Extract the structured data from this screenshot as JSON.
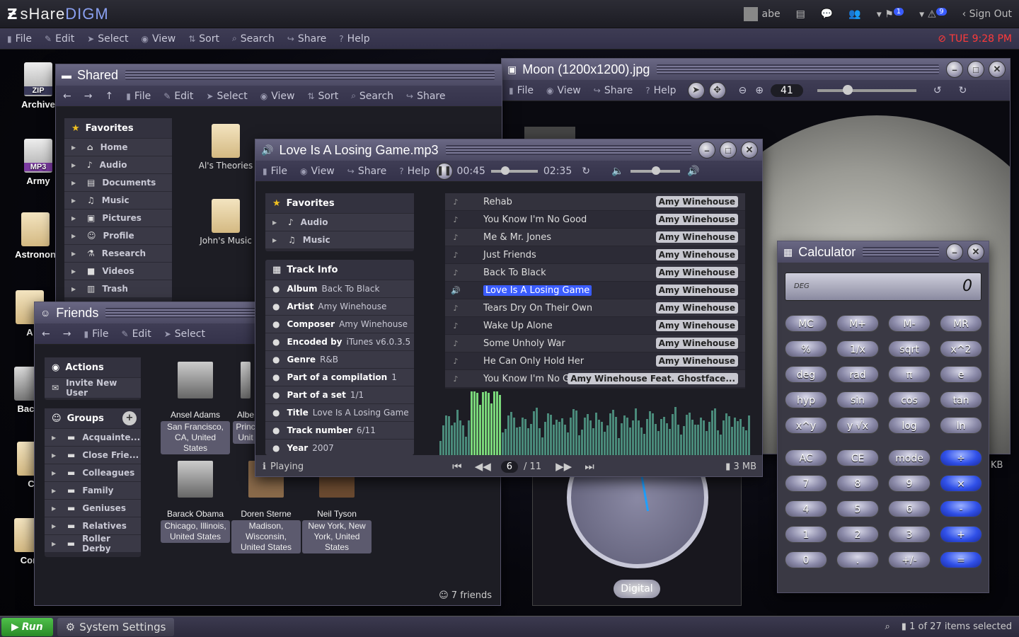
{
  "topbar": {
    "logo_a": "sHare",
    "logo_b": "DIGM",
    "user": "abe",
    "notif1": "1",
    "notif2": "9",
    "signout": "Sign Out"
  },
  "menubar": {
    "items": [
      "File",
      "Edit",
      "Select",
      "View",
      "Sort",
      "Search",
      "Share",
      "Help"
    ],
    "clock": "TUE 9:28 PM"
  },
  "desktop": {
    "icons": [
      "Archive",
      "Army",
      "Astronon",
      "A",
      "Back",
      "C",
      "Cor"
    ],
    "zip": "ZIP",
    "mp3": "MP3"
  },
  "shared": {
    "title": "Shared",
    "tools": [
      "File",
      "Edit",
      "Select",
      "View",
      "Sort",
      "Search",
      "Share"
    ],
    "fav_title": "Favorites",
    "fav": [
      "Home",
      "Audio",
      "Documents",
      "Music",
      "Pictures",
      "Profile",
      "Research",
      "Videos",
      "Trash"
    ],
    "files": [
      "Al's Theories",
      "John's Music"
    ]
  },
  "friends": {
    "title": "Friends",
    "tools": [
      "File",
      "Edit",
      "Select"
    ],
    "actions": "Actions",
    "invite": "Invite New User",
    "groups": "Groups",
    "group_items": [
      "Acquainte...",
      "Close Frie...",
      "Colleagues",
      "Family",
      "Geniuses",
      "Relatives",
      "Roller Derby"
    ],
    "people": [
      {
        "name": "Ansel Adams",
        "loc": "San Francisco, CA, United States"
      },
      {
        "name": "Albe",
        "loc": "Princ Unit"
      },
      {
        "name": "Barack Obama",
        "loc": "Chicago, Illinois, United States"
      },
      {
        "name": "Doren Sterne",
        "loc": "Madison, Wisconsin, United States"
      },
      {
        "name": "Neil Tyson",
        "loc": "New York, New York, United States"
      }
    ],
    "count": "7 friends"
  },
  "moon": {
    "title": "Moon (1200x1200).jpg",
    "tools": [
      "File",
      "View",
      "Share",
      "Help"
    ],
    "zoom": "41"
  },
  "player": {
    "title": "Love Is A Losing Game.mp3",
    "tools": [
      "File",
      "View",
      "Share",
      "Help"
    ],
    "time_cur": "00:45",
    "time_total": "02:35",
    "fav_title": "Favorites",
    "fav": [
      "Audio",
      "Music"
    ],
    "info_title": "Track Info",
    "info": [
      {
        "k": "Album",
        "v": "Back To Black"
      },
      {
        "k": "Artist",
        "v": "Amy Winehouse"
      },
      {
        "k": "Composer",
        "v": "Amy Winehouse"
      },
      {
        "k": "Encoded by",
        "v": "iTunes v6.0.3.5"
      },
      {
        "k": "Genre",
        "v": "R&B"
      },
      {
        "k": "Part of a compilation",
        "v": "1"
      },
      {
        "k": "Part of a set",
        "v": "1/1"
      },
      {
        "k": "Title",
        "v": "Love Is A Losing Game"
      },
      {
        "k": "Track number",
        "v": "6/11"
      },
      {
        "k": "Year",
        "v": "2007"
      }
    ],
    "tracks": [
      {
        "t": "Rehab",
        "a": "Amy Winehouse"
      },
      {
        "t": "You Know I'm No Good",
        "a": "Amy Winehouse"
      },
      {
        "t": "Me & Mr. Jones",
        "a": "Amy Winehouse"
      },
      {
        "t": "Just Friends",
        "a": "Amy Winehouse"
      },
      {
        "t": "Back To Black",
        "a": "Amy Winehouse"
      },
      {
        "t": "Love Is A Losing Game",
        "a": "Amy Winehouse"
      },
      {
        "t": "Tears Dry On Their Own",
        "a": "Amy Winehouse"
      },
      {
        "t": "Wake Up Alone",
        "a": "Amy Winehouse"
      },
      {
        "t": "Some Unholy War",
        "a": "Amy Winehouse"
      },
      {
        "t": "He Can Only Hold Her",
        "a": "Amy Winehouse"
      },
      {
        "t": "You Know I'm No Good [...",
        "a": "Amy Winehouse Feat. Ghostface..."
      }
    ],
    "status": "Playing",
    "track_num": "6",
    "track_total": "/ 11",
    "size": "3 MB",
    "progress": 0.29
  },
  "calc": {
    "title": "Calculator",
    "mode": "DEG",
    "display": "0",
    "keys": [
      "MC",
      "M+",
      "M-",
      "MR",
      "%",
      "1/x",
      "sqrt",
      "x^2",
      "deg",
      "rad",
      "π",
      "e",
      "hyp",
      "sin",
      "cos",
      "tan",
      "x^y",
      "y √x",
      "log",
      "ln",
      "AC",
      "CE",
      "mode",
      "÷",
      "7",
      "8",
      "9",
      "×",
      "4",
      "5",
      "6",
      "-",
      "1",
      "2",
      "3",
      "+",
      "0",
      ".",
      "+/-",
      "="
    ]
  },
  "clockwidget": {
    "label": "Digital"
  },
  "statusbar": {
    "run": "Run",
    "settings": "System Settings",
    "selection": "1 of 27 items selected",
    "kb": "KB"
  },
  "colors": {
    "accent": "#3a5cff",
    "clock": "#ff3a3a",
    "run": "#3fa03a"
  }
}
